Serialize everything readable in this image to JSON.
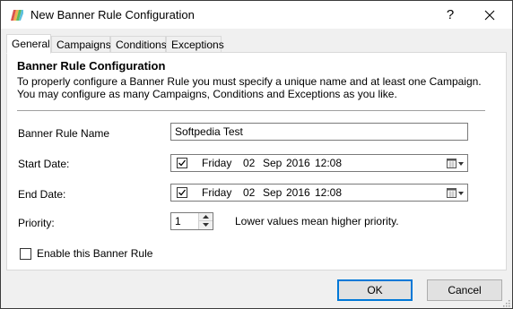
{
  "window": {
    "title": "New Banner Rule Configuration",
    "help_label": "?"
  },
  "tabs": [
    {
      "label": "General",
      "active": true
    },
    {
      "label": "Campaigns",
      "active": false
    },
    {
      "label": "Conditions",
      "active": false
    },
    {
      "label": "Exceptions",
      "active": false
    }
  ],
  "section": {
    "title": "Banner Rule Configuration",
    "description": "To properly configure a Banner Rule you must specify a unique name and at least one Campaign. You may configure as many Campaigns, Conditions and Exceptions as you like."
  },
  "form": {
    "name_label": "Banner Rule Name",
    "name_value": "Softpedia Test",
    "start_label": "Start Date:",
    "start": {
      "checked": true,
      "weekday": "Friday",
      "day": "02",
      "month": "Sep",
      "year": "2016",
      "time": "12:08"
    },
    "end_label": "End Date:",
    "end": {
      "checked": true,
      "weekday": "Friday",
      "day": "02",
      "month": "Sep",
      "year": "2016",
      "time": "12:08"
    },
    "priority_label": "Priority:",
    "priority_value": "1",
    "priority_hint": "Lower values mean higher priority.",
    "enable_label": "Enable this Banner Rule",
    "enable_checked": false
  },
  "buttons": {
    "ok": "OK",
    "cancel": "Cancel"
  },
  "colors": {
    "accent": "#0078d7",
    "dialog_bg": "#f0f0f0",
    "panel_bg": "#ffffff"
  },
  "icons": {
    "app": "app-icon",
    "close": "close-icon",
    "calendar": "calendar-icon",
    "spin_up": "spin-up-icon",
    "spin_down": "spin-down-icon",
    "check": "checkmark-icon",
    "grip": "resize-grip-icon"
  }
}
